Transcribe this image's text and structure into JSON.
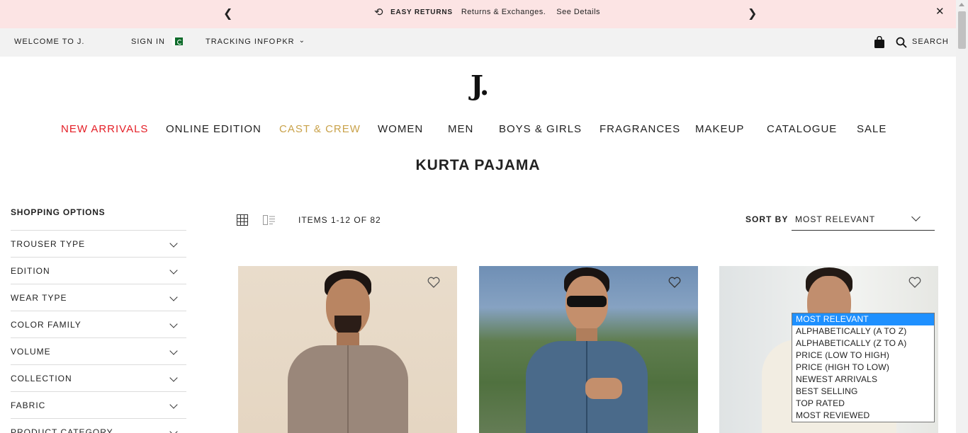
{
  "colors": {
    "accent_red": "#e41e26",
    "accent_gold": "#c9a24a",
    "promo_bg": "#fce4e4",
    "topbar_bg": "#f2f2f2",
    "selected_option": "#1e90ff"
  },
  "promo": {
    "prev_icon": "chevron-left",
    "next_icon": "chevron-right",
    "return_icon": "undo-arrow",
    "title": "EASY RETURNS",
    "text": "Returns & Exchanges.",
    "link": "See Details",
    "close_icon": "close-x"
  },
  "topbar": {
    "welcome": "WELCOME TO J.",
    "sign_in": "SIGN IN",
    "flag_icon": "pakistan-flag",
    "tracking": "TRACKING INFO",
    "currency": "PKR",
    "bag_icon": "shopping-bag",
    "search_icon": "magnifier",
    "search": "SEARCH"
  },
  "logo": "J.",
  "nav": {
    "items": [
      {
        "label": "NEW ARRIVALS",
        "color": "#e41e26"
      },
      {
        "label": "ONLINE EDITION",
        "color": "#222222"
      },
      {
        "label": "CAST & CREW",
        "color": "#c9a24a"
      },
      {
        "label": "WOMEN",
        "color": "#222222"
      },
      {
        "label": "MEN",
        "color": "#222222"
      },
      {
        "label": "BOYS & GIRLS",
        "color": "#222222"
      },
      {
        "label": "FRAGRANCES",
        "color": "#222222"
      },
      {
        "label": "MAKEUP",
        "color": "#222222"
      },
      {
        "label": "CATALOGUE",
        "color": "#222222"
      },
      {
        "label": "SALE",
        "color": "#222222"
      }
    ]
  },
  "page_title": "KURTA PAJAMA",
  "sidebar": {
    "heading": "SHOPPING OPTIONS",
    "filters": [
      {
        "label": "TROUSER TYPE"
      },
      {
        "label": "EDITION"
      },
      {
        "label": "WEAR TYPE"
      },
      {
        "label": "COLOR FAMILY"
      },
      {
        "label": "VOLUME"
      },
      {
        "label": "COLLECTION"
      },
      {
        "label": "FABRIC"
      },
      {
        "label": "PRODUCT CATEGORY"
      }
    ]
  },
  "toolbar": {
    "grid_icon": "grid-view",
    "list_icon": "list-view",
    "items_count": "ITEMS 1-12 OF 82",
    "sort_label": "SORT BY",
    "sort_value": "MOST RELEVANT"
  },
  "sort_options": [
    "MOST RELEVANT",
    "ALPHABETICALLY (A TO Z)",
    "ALPHABETICALLY (Z TO A)",
    "PRICE (LOW TO HIGH)",
    "PRICE (HIGH TO LOW)",
    "NEWEST ARRIVALS",
    "BEST SELLING",
    "TOP RATED",
    "MOST REVIEWED"
  ],
  "products": [
    {
      "wishlist_icon": "heart-outline",
      "kurta_color": "#9a877a"
    },
    {
      "wishlist_icon": "heart-outline",
      "kurta_color": "#4a6a8a"
    },
    {
      "wishlist_icon": "heart-outline",
      "kurta_color": "#f2ede2"
    }
  ]
}
